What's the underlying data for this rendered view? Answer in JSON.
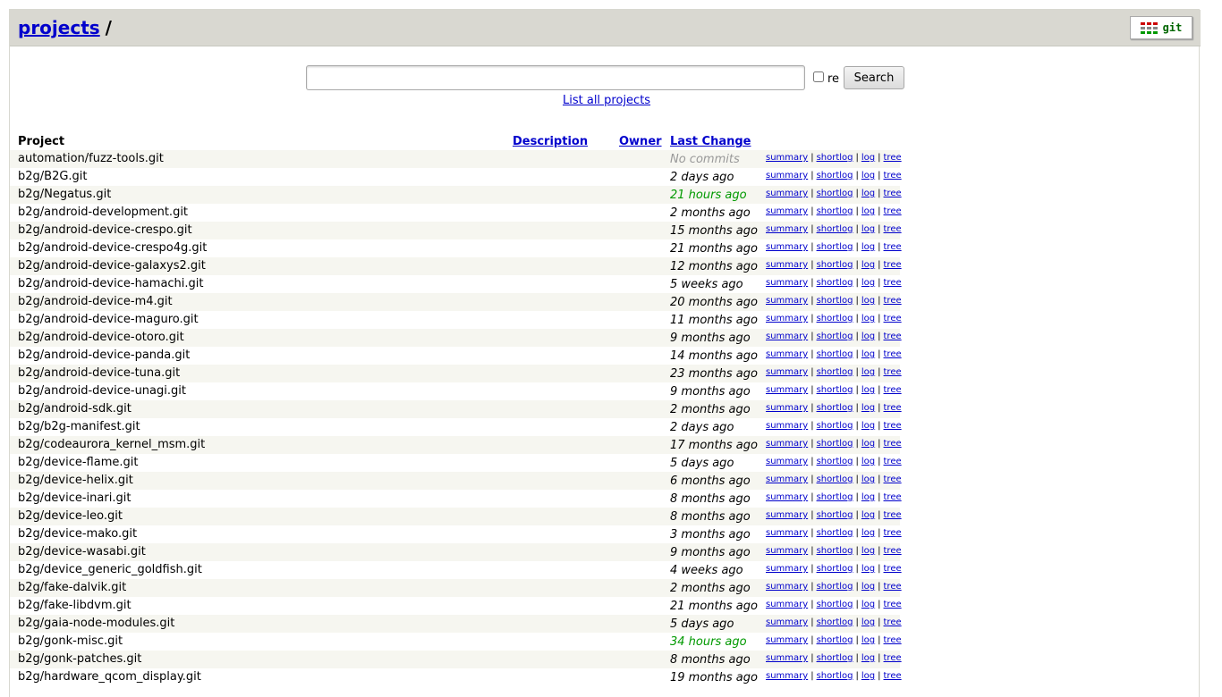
{
  "header": {
    "breadcrumb_link": "projects",
    "breadcrumb_sep": "/",
    "logo_text": "git"
  },
  "search": {
    "value": "",
    "placeholder": "",
    "regex_label": "re",
    "button_label": "Search",
    "list_all_label": "List all projects"
  },
  "table": {
    "headers": {
      "project": "Project",
      "description": "Description",
      "owner": "Owner",
      "last_change": "Last Change"
    },
    "action_labels": [
      "summary",
      "shortlog",
      "log",
      "tree"
    ],
    "rows": [
      {
        "project": "automation/fuzz-tools.git",
        "age": "No commits",
        "age_style": "none"
      },
      {
        "project": "b2g/B2G.git",
        "age": "2 days ago",
        "age_style": "normal"
      },
      {
        "project": "b2g/Negatus.git",
        "age": "21 hours ago",
        "age_style": "recent"
      },
      {
        "project": "b2g/android-development.git",
        "age": "2 months ago",
        "age_style": "normal"
      },
      {
        "project": "b2g/android-device-crespo.git",
        "age": "15 months ago",
        "age_style": "normal"
      },
      {
        "project": "b2g/android-device-crespo4g.git",
        "age": "21 months ago",
        "age_style": "normal"
      },
      {
        "project": "b2g/android-device-galaxys2.git",
        "age": "12 months ago",
        "age_style": "normal"
      },
      {
        "project": "b2g/android-device-hamachi.git",
        "age": "5 weeks ago",
        "age_style": "normal"
      },
      {
        "project": "b2g/android-device-m4.git",
        "age": "20 months ago",
        "age_style": "normal"
      },
      {
        "project": "b2g/android-device-maguro.git",
        "age": "11 months ago",
        "age_style": "normal"
      },
      {
        "project": "b2g/android-device-otoro.git",
        "age": "9 months ago",
        "age_style": "normal"
      },
      {
        "project": "b2g/android-device-panda.git",
        "age": "14 months ago",
        "age_style": "normal"
      },
      {
        "project": "b2g/android-device-tuna.git",
        "age": "23 months ago",
        "age_style": "normal"
      },
      {
        "project": "b2g/android-device-unagi.git",
        "age": "9 months ago",
        "age_style": "normal"
      },
      {
        "project": "b2g/android-sdk.git",
        "age": "2 months ago",
        "age_style": "normal"
      },
      {
        "project": "b2g/b2g-manifest.git",
        "age": "2 days ago",
        "age_style": "normal"
      },
      {
        "project": "b2g/codeaurora_kernel_msm.git",
        "age": "17 months ago",
        "age_style": "normal"
      },
      {
        "project": "b2g/device-flame.git",
        "age": "5 days ago",
        "age_style": "normal"
      },
      {
        "project": "b2g/device-helix.git",
        "age": "6 months ago",
        "age_style": "normal"
      },
      {
        "project": "b2g/device-inari.git",
        "age": "8 months ago",
        "age_style": "normal"
      },
      {
        "project": "b2g/device-leo.git",
        "age": "8 months ago",
        "age_style": "normal"
      },
      {
        "project": "b2g/device-mako.git",
        "age": "3 months ago",
        "age_style": "normal"
      },
      {
        "project": "b2g/device-wasabi.git",
        "age": "9 months ago",
        "age_style": "normal"
      },
      {
        "project": "b2g/device_generic_goldfish.git",
        "age": "4 weeks ago",
        "age_style": "normal"
      },
      {
        "project": "b2g/fake-dalvik.git",
        "age": "2 months ago",
        "age_style": "normal"
      },
      {
        "project": "b2g/fake-libdvm.git",
        "age": "21 months ago",
        "age_style": "normal"
      },
      {
        "project": "b2g/gaia-node-modules.git",
        "age": "5 days ago",
        "age_style": "normal"
      },
      {
        "project": "b2g/gonk-misc.git",
        "age": "34 hours ago",
        "age_style": "recent"
      },
      {
        "project": "b2g/gonk-patches.git",
        "age": "8 months ago",
        "age_style": "normal"
      },
      {
        "project": "b2g/hardware_qcom_display.git",
        "age": "19 months ago",
        "age_style": "normal"
      }
    ]
  },
  "colors": {
    "header_bg": "#d9d8d1",
    "link": "#0000cc",
    "recent_age": "#009900",
    "no_commits": "#999999",
    "odd_row": "#f6f6f0"
  }
}
